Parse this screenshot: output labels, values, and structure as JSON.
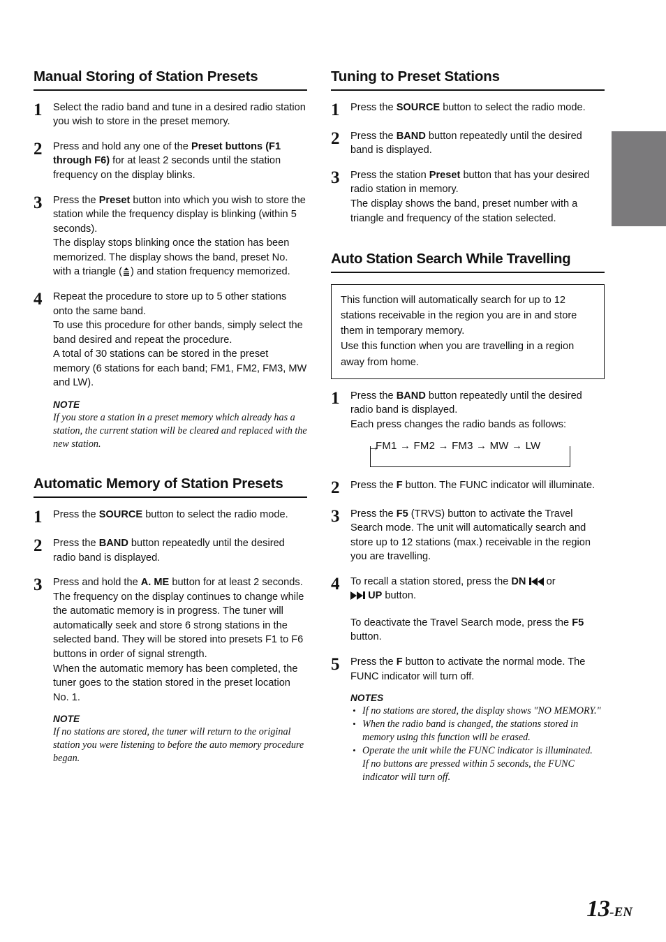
{
  "page": {
    "number": "13",
    "suffix": "-EN",
    "edge_tab_color": "#7b7a7c"
  },
  "left_column": {
    "sections": [
      {
        "title": "Manual Storing of Station Presets",
        "steps": [
          {
            "num": "1",
            "lines": [
              "Select the radio band and tune in a desired radio station you wish to store in the preset memory."
            ]
          },
          {
            "num": "2",
            "lines": [
              "Press and hold any one of the ",
              "Preset buttons (F1 through F6)",
              " for at least 2 seconds until the station frequency on the display blinks."
            ]
          },
          {
            "num": "3",
            "line1_a": "Press the ",
            "line1_b": "Preset",
            "line1_c": " button into which you wish to store the station while the frequency display is blinking (within 5 seconds).",
            "line2_a": "The display stops blinking once the station has been memorized. The display shows the band, preset No. with a triangle (",
            "line2_b": ") and station frequency memorized."
          },
          {
            "num": "4",
            "p1": "Repeat the procedure to store up to 5 other stations onto the same band.",
            "p2": "To use this procedure for other bands, simply select the band desired and repeat the procedure.",
            "p3": "A total of 30 stations can be stored in the preset memory (6 stations for each band; FM1, FM2, FM3, MW and LW).",
            "note_head": "NOTE",
            "note_text": "If you store a station in a preset memory which already has a station, the current station will be cleared and replaced with the new station."
          }
        ]
      },
      {
        "title": "Automatic Memory of Station Presets",
        "steps": [
          {
            "num": "1",
            "a": "Press the ",
            "b": "SOURCE",
            "c": " button to select the radio mode."
          },
          {
            "num": "2",
            "a": "Press the ",
            "b": "BAND",
            "c": " button repeatedly until the desired radio band is displayed."
          },
          {
            "num": "3",
            "a": "Press and hold the ",
            "b": "A. ME",
            "c": " button for at least 2 seconds.",
            "p2": "The frequency on the display continues to change while the automatic memory is in progress. The tuner will automatically seek and store 6 strong stations in the selected band. They will be stored into presets F1 to F6 buttons in order of signal strength.",
            "p3": "When the automatic memory has been completed, the tuner goes to the station stored in the preset location No. 1.",
            "note_head": "NOTE",
            "note_text": "If no stations are stored, the tuner will return to the original station you were listening to before the auto memory procedure began."
          }
        ]
      }
    ]
  },
  "right_column": {
    "sections": [
      {
        "title": "Tuning to Preset Stations",
        "steps": [
          {
            "num": "1",
            "a": "Press the ",
            "b": "SOURCE",
            "c": " button to select the radio mode."
          },
          {
            "num": "2",
            "a": "Press the ",
            "b": "BAND",
            "c": " button repeatedly until the desired band is displayed."
          },
          {
            "num": "3",
            "a": "Press the station ",
            "b": "Preset",
            "c": " button that has your desired radio station in memory.",
            "p2": "The display shows the band, preset number with a triangle and frequency of the station selected."
          }
        ]
      },
      {
        "title": "Auto Station Search While Travelling",
        "callout": {
          "p1": "This function will automatically search for up to 12 stations receivable in the region you are in and store them in temporary memory.",
          "p2": "Use this function when you are travelling in a region away from home."
        },
        "steps": [
          {
            "num": "1",
            "a": "Press the ",
            "b": "BAND",
            "c": " button repeatedly until the desired radio band is displayed.",
            "p2": "Each press changes the radio bands as follows:",
            "cycle": "FM1 → FM2 → FM3 → MW → LW"
          },
          {
            "num": "2",
            "a": "Press the ",
            "b": "F",
            "c": " button. The FUNC indicator will illuminate."
          },
          {
            "num": "3",
            "a": "Press the ",
            "b": "F5",
            "c": " (TRVS) button to activate the Travel Search mode. The unit will automatically search and store up to 12 stations (max.) receivable in the region you are travelling."
          },
          {
            "num": "4",
            "a": "To recall a station stored, press the ",
            "b_dn": "DN",
            "mid": " or",
            "b_up": "UP",
            "c": " button.",
            "p2_a": "To deactivate the Travel Search mode, press the ",
            "p2_b": "F5",
            "p2_c": " button."
          },
          {
            "num": "5",
            "a": "Press the ",
            "b": "F",
            "c": " button to activate the normal mode. The FUNC indicator will turn off.",
            "notes_head": "NOTES",
            "notes": [
              "If no stations are stored, the display shows \"NO MEMORY.\"",
              "When the radio band is changed, the stations stored in memory using this function will be erased.",
              "Operate the unit while the FUNC indicator is illuminated.\nIf no buttons are pressed within 5 seconds, the FUNC indicator will turn off."
            ]
          }
        ]
      }
    ]
  }
}
